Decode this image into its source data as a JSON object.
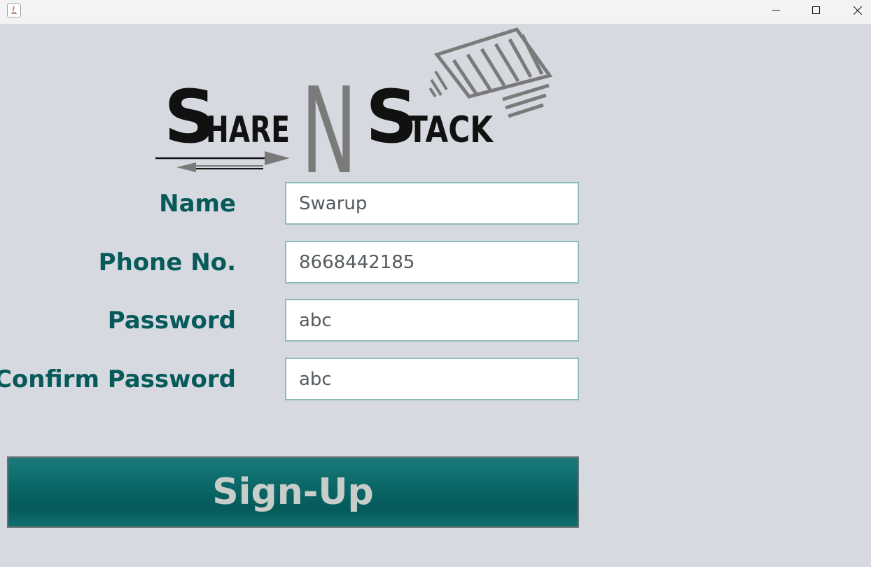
{
  "window": {
    "controls": {
      "minimize_icon": "minimize-icon",
      "maximize_icon": "maximize-icon",
      "close_icon": "close-icon"
    }
  },
  "logo": {
    "word1_initial": "S",
    "word1_rest": "HARE",
    "middle": "N",
    "word2_initial": "S",
    "word2_rest": "TACK"
  },
  "form": {
    "name_label": "Name",
    "name_value": "Swarup",
    "phone_label": "Phone No.",
    "phone_value": "8668442185",
    "password_label": "Password",
    "password_value": "abc",
    "confirm_label": "Confirm Password",
    "confirm_value": "abc"
  },
  "signup_label": "Sign-Up",
  "colors": {
    "background": "#d6d9e0",
    "label": "#075a5a",
    "button": "#0b6868",
    "button_text": "#c9cdc9"
  }
}
